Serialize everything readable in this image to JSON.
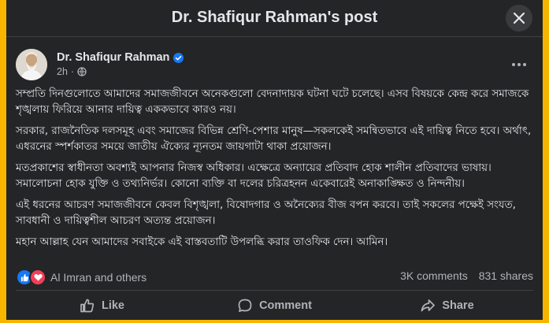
{
  "dialog": {
    "title": "Dr. Shafiqur Rahman's post"
  },
  "post": {
    "author": "Dr. Shafiqur Rahman",
    "time": "2h",
    "paragraphs": [
      "সম্প্রতি দিনগুলোতে আমাদের সমাজজীবনে অনেকগুলো বেদনাদায়ক ঘটনা ঘটে চলেছে। এসব বিষয়কে কেন্দ্র করে সমাজকে শৃঙ্খলায় ফিরিয়ে আনার দায়িত্ব এককভাবে কারও নয়।",
      "সরকার, রাজনৈতিক দলসমূহ এবং সমাজের বিভিন্ন শ্রেণি-পেশার মানুষ—সকলকেই সমন্বিতভাবে এই দায়িত্ব নিতে হবে। অর্থাৎ, এধরনের স্পর্শকাতর সময়ে জাতীয় ঐক্যের ন্যূনতম জায়গাটা থাকা প্রয়োজন।",
      "মতপ্রকাশের স্বাধীনতা অবশ্যই আপনার নিজস্ব অধিকার। এক্ষেত্রে অন্যায়ের প্রতিবাদ হোক শালীন প্রতিবাদের ভাষায়। সমালোচনা হোক যুক্তি ও তথ্যনির্ভর। কোনো ব্যক্তি বা দলের চরিত্রহনন একেবারেই অনাকাঙ্ক্ষিত ও নিন্দনীয়।",
      "এই ধরনের আচরণ সমাজজীবনে কেবল বিশৃঙ্খলা, বিষোদগার ও অনৈক্যের বীজ বপন করবে। তাই সকলের পক্ষেই সংযত, সাবধানী ও দায়িত্বশীল আচরণ অত্যন্ত প্রয়োজন।",
      "মহান আল্লাহ যেন আমাদের সবাইকে এই বাস্তবতাটি উপলব্ধি করার তাওফিক দেন। আমিন।"
    ]
  },
  "stats": {
    "reactors": "Al Imran and others",
    "comments": "3K comments",
    "shares": "831 shares"
  },
  "actions": {
    "like": "Like",
    "comment": "Comment",
    "share": "Share"
  },
  "colors": {
    "frame": "#f7b500",
    "background": "#242526",
    "verified": "#1877f2",
    "like": "#1877f2",
    "love": "#f33e58"
  },
  "icons": [
    "close-icon",
    "verified-badge-icon",
    "globe-icon",
    "more-options-icon",
    "like-reaction-icon",
    "love-reaction-icon",
    "like-icon",
    "comment-icon",
    "share-icon"
  ]
}
